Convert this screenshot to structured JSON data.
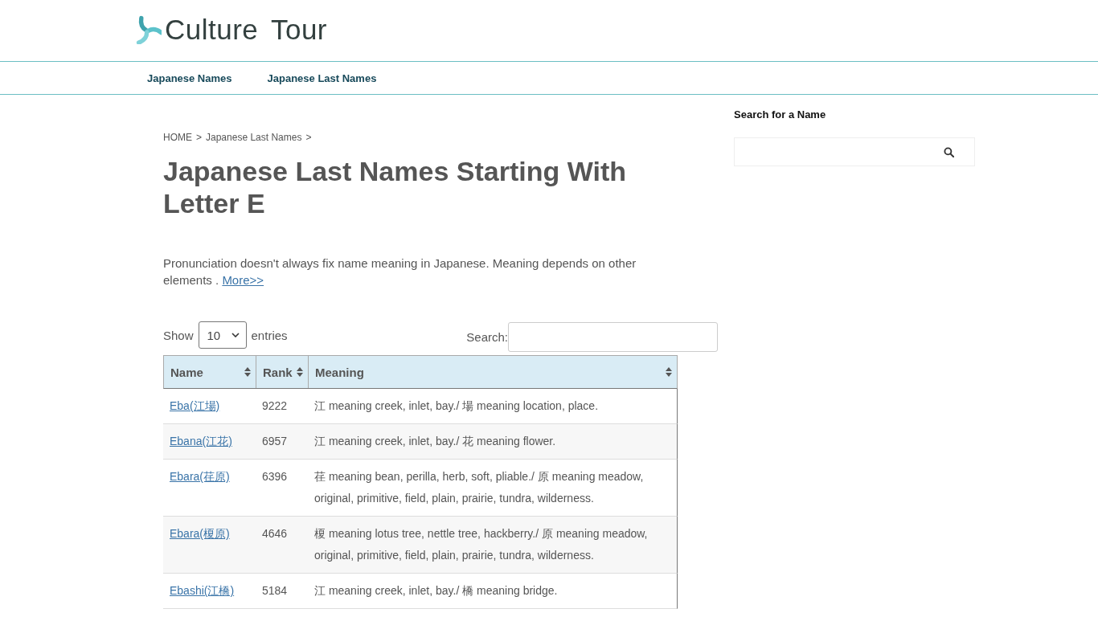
{
  "header": {
    "site_name": "Culture Tour"
  },
  "nav": {
    "items": [
      {
        "label": "Japanese Names"
      },
      {
        "label": "Japanese Last Names"
      }
    ]
  },
  "breadcrumb": [
    {
      "label": "HOME",
      "separator": ">"
    },
    {
      "label": "Japanese Last Names",
      "separator": ">"
    }
  ],
  "title": "Japanese Last Names Starting With Letter E",
  "intro": {
    "text": "Pronunciation doesn't always fix name meaning in Japanese. Meaning depends on other elements .",
    "link": "More>>"
  },
  "table_controls": {
    "show_label": "Show",
    "page_size": "10",
    "entries_label": "entries",
    "search_label": "Search:"
  },
  "table": {
    "columns": [
      {
        "label": "Name"
      },
      {
        "label": "Rank"
      },
      {
        "label": "Meaning"
      }
    ],
    "rows": [
      {
        "name": "Eba(江場)",
        "rank": "9222",
        "meaning": "江 meaning creek, inlet, bay./ 場 meaning location, place."
      },
      {
        "name": "Ebana(江花)",
        "rank": "6957",
        "meaning": "江 meaning creek, inlet, bay./ 花 meaning flower."
      },
      {
        "name": "Ebara(荏原)",
        "rank": "6396",
        "meaning": "荏 meaning bean, perilla, herb, soft, pliable./ 原 meaning meadow, original, primitive, field, plain, prairie, tundra, wilderness."
      },
      {
        "name": "Ebara(榎原)",
        "rank": "4646",
        "meaning": "榎 meaning lotus tree, nettle tree, hackberry./ 原 meaning meadow, original, primitive, field, plain, prairie, tundra, wilderness."
      },
      {
        "name": "Ebashi(江橋)",
        "rank": "5184",
        "meaning": "江 meaning creek, inlet, bay./ 橋 meaning bridge."
      }
    ]
  },
  "sidebar": {
    "title": "Search for a Name"
  }
}
